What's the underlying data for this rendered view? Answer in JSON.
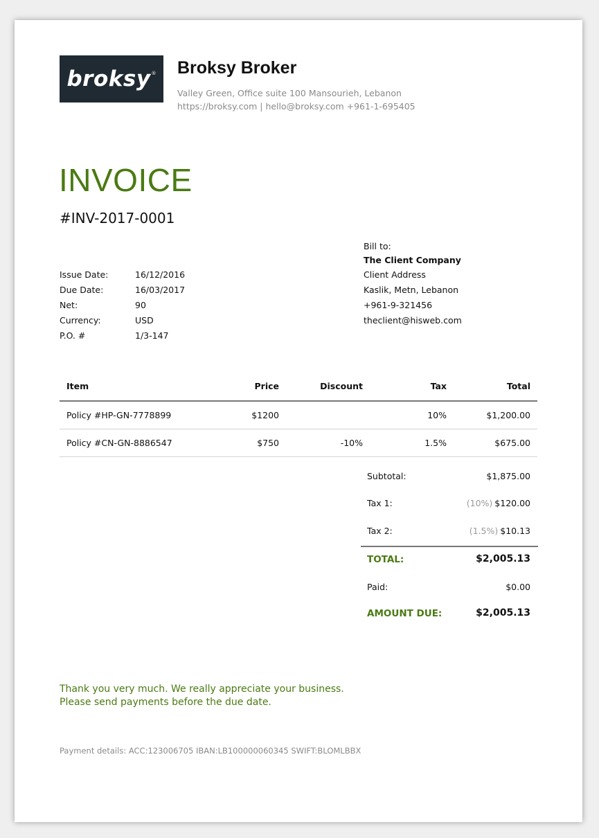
{
  "company": {
    "logo_text": "broksy",
    "logo_mark": "®",
    "name": "Broksy Broker",
    "address": "Valley Green, Office suite 100 Mansourieh, Lebanon",
    "contact": "https://broksy.com | hello@broksy.com +961-1-695405"
  },
  "invoice": {
    "title": "INVOICE",
    "number": "#INV-2017-0001"
  },
  "meta": [
    {
      "label": "Issue Date:",
      "value": "16/12/2016"
    },
    {
      "label": "Due Date:",
      "value": "16/03/2017"
    },
    {
      "label": "Net:",
      "value": "90"
    },
    {
      "label": "Currency:",
      "value": "USD"
    },
    {
      "label": "P.O. #",
      "value": "1/3-147"
    }
  ],
  "bill_to": {
    "heading": "Bill to:",
    "company": "The Client Company",
    "address": "Client Address",
    "city": "Kaslik, Metn, Lebanon",
    "phone": "+961-9-321456",
    "email": "theclient@hisweb.com"
  },
  "table": {
    "headers": {
      "item": "Item",
      "price": "Price",
      "discount": "Discount",
      "tax": "Tax",
      "total": "Total"
    },
    "rows": [
      {
        "item": "Policy #HP-GN-7778899",
        "price": "$1200",
        "discount": "",
        "tax": "10%",
        "total": "$1,200.00"
      },
      {
        "item": "Policy #CN-GN-8886547",
        "price": "$750",
        "discount": "-10%",
        "tax": "1.5%",
        "total": "$675.00"
      }
    ]
  },
  "totals": {
    "subtotal_label": "Subtotal:",
    "subtotal_value": "$1,875.00",
    "tax1_label": "Tax 1:",
    "tax1_rate": "(10%)",
    "tax1_value": "$120.00",
    "tax2_label": "Tax 2:",
    "tax2_rate": "(1.5%)",
    "tax2_value": "$10.13",
    "total_label": "TOTAL:",
    "total_value": "$2,005.13",
    "paid_label": "Paid:",
    "paid_value": "$0.00",
    "due_label": "AMOUNT DUE:",
    "due_value": "$2,005.13"
  },
  "footer": {
    "thanks_line1": "Thank you very much. We really appreciate your business.",
    "thanks_line2": "Please send payments before the due date.",
    "payment_details": "Payment details: ACC:123006705 IBAN:LB100000060345 SWIFT:BLOMLBBX"
  },
  "colors": {
    "accent": "#4a7a12",
    "logo_background": "#1f2a33",
    "muted_text": "#8a8a8a"
  }
}
